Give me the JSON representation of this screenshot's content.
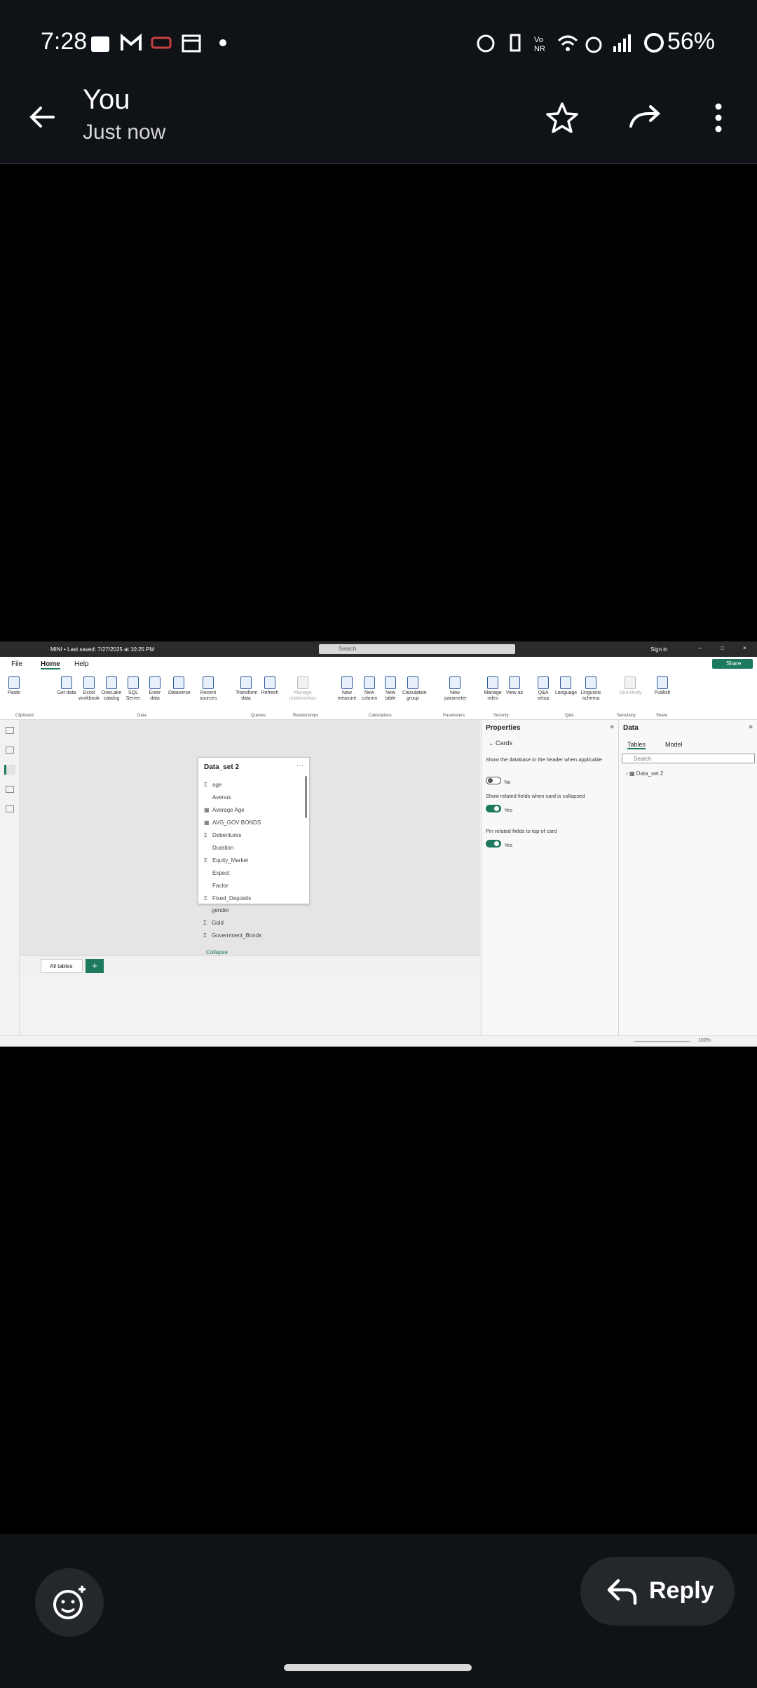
{
  "status": {
    "time": "7:28",
    "battery": "56%"
  },
  "header": {
    "title": "You",
    "subtitle": "Just now"
  },
  "powerbi": {
    "window_title": "MINI • Last saved: 7/27/2025 at 10:25 PM",
    "search_placeholder": "Search",
    "sign_in": "Sign in",
    "share": "Share",
    "menu_tabs": [
      "File",
      "Home",
      "Help"
    ],
    "ribbon_buttons": [
      "Paste",
      "Get data",
      "Excel workbook",
      "OneLake catalog",
      "SQL Server",
      "Enter data",
      "Dataverse",
      "Recent sources",
      "Transform data",
      "Refresh",
      "Manage relationships",
      "New measure",
      "New column",
      "New table",
      "Calculation group",
      "New parameter",
      "Manage roles",
      "View as",
      "Q&A setup",
      "Language",
      "Linguistic schema",
      "Sensitivity",
      "Publish"
    ],
    "ribbon_groups": [
      "Clipboard",
      "Data",
      "Queries",
      "Relationships",
      "Calculations",
      "Parameters",
      "Security",
      "Q&A",
      "Sensitivity",
      "Share"
    ],
    "card": {
      "title": "Data_set 2",
      "fields": [
        "age",
        "Avenus",
        "Average Age",
        "AVG_GOV BONDS",
        "Debentures",
        "Duration",
        "Equity_Market",
        "Expect",
        "Factor",
        "Fixed_Deposits",
        "gender",
        "Gold",
        "Government_Bonds"
      ],
      "collapse_label": "Collapse"
    },
    "bottom_tab": "All tables",
    "properties": {
      "title": "Properties",
      "section": "Cards",
      "opt1_label": "Show the database in the header when applicable",
      "opt1_value": "No",
      "opt2_label": "Show related fields when card is collapsed",
      "opt2_value": "Yes",
      "opt3_label": "Pin related fields to top of card",
      "opt3_value": "Yes"
    },
    "data_pane": {
      "title": "Data",
      "tab_tables": "Tables",
      "tab_model": "Model",
      "search_placeholder": "Search",
      "table_item": "Data_set 2"
    },
    "zoom": "100%"
  },
  "reply": {
    "label": "Reply"
  }
}
